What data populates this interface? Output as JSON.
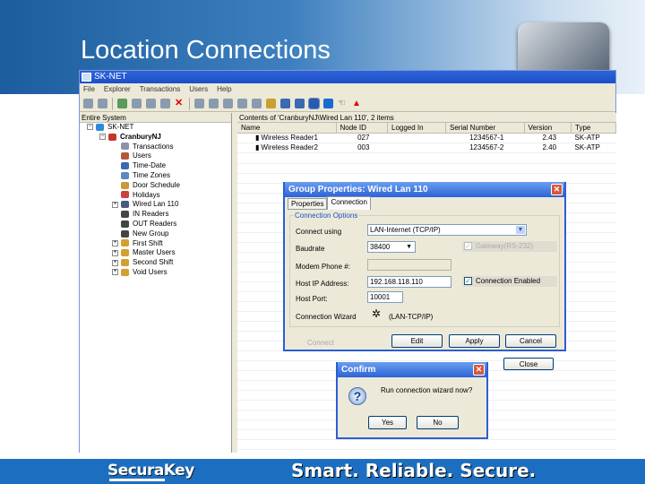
{
  "slide": {
    "title": "Location Connections",
    "footer_logo": "SecuraKey",
    "footer_tagline": "Smart. Reliable. Secure."
  },
  "app": {
    "title": "SK-NET",
    "menu": [
      "File",
      "Explorer",
      "Transactions",
      "Users",
      "Help"
    ],
    "tree_header": "Entire System",
    "tree": [
      {
        "label": "SK-NET",
        "color": "#2a8ad6"
      },
      {
        "label": "CranburyNJ",
        "color": "#c0392b"
      },
      {
        "label": "Transactions",
        "color": "#8a95a8"
      },
      {
        "label": "Users",
        "color": "#b05a3a"
      },
      {
        "label": "Time-Date",
        "color": "#3a6ab0"
      },
      {
        "label": "Time Zones",
        "color": "#5a8ac0"
      },
      {
        "label": "Door Schedule",
        "color": "#c89a3a"
      },
      {
        "label": "Holidays",
        "color": "#d04040"
      },
      {
        "label": "Wired Lan 110",
        "color": "#4a5a7a"
      },
      {
        "label": "IN Readers",
        "color": "#444"
      },
      {
        "label": "OUT Readers",
        "color": "#444"
      },
      {
        "label": "New Group",
        "color": "#444"
      },
      {
        "label": "First Shift",
        "color": "#d0a030"
      },
      {
        "label": "Master Users",
        "color": "#d0a030"
      },
      {
        "label": "Second Shift",
        "color": "#d0a030"
      },
      {
        "label": "Void Users",
        "color": "#d0a030"
      }
    ],
    "contents_header": "Contents of 'CranburyNJ\\Wired Lan 110', 2 items",
    "columns": [
      "Name",
      "Node ID",
      "Logged In",
      "Serial Number",
      "Version",
      "Type"
    ],
    "rows": [
      [
        "Wireless Reader1",
        "027",
        "",
        "1234567-1",
        "2.43",
        "SK-ATP"
      ],
      [
        "Wireless Reader2",
        "003",
        "",
        "1234567-2",
        "2.40",
        "SK-ATP"
      ]
    ]
  },
  "group_dialog": {
    "title": "Group Properties: Wired Lan 110",
    "tabs": [
      "Properties",
      "Connection"
    ],
    "fieldset": "Connection Options",
    "connect_using_label": "Connect using",
    "connect_using": "LAN-Internet (TCP/IP)",
    "baud_label": "Baudrate",
    "baud": "38400",
    "gateway_label": "Gateway(RS-232)",
    "modem_label": "Modem Phone #:",
    "modem": "",
    "ip_label": "Host IP Address:",
    "ip": "192.168.118.110",
    "enabled_label": "Connection Enabled",
    "port_label": "Host Port:",
    "port": "10001",
    "wizard_label": "Connection Wizard",
    "wizard": "(LAN-TCP/IP)",
    "connect": "Connect",
    "edit": "Edit",
    "apply": "Apply",
    "cancel": "Cancel",
    "close": "Close"
  },
  "confirm": {
    "title": "Confirm",
    "message": "Run connection wizard now?",
    "yes": "Yes",
    "no": "No"
  }
}
